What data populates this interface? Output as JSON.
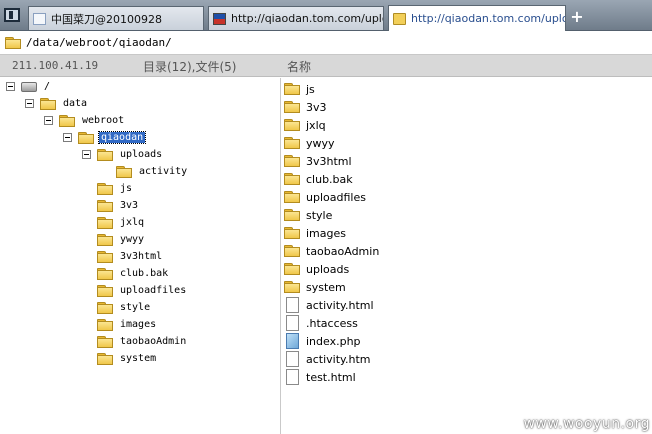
{
  "tabs": [
    {
      "label": "中国菜刀@20100928",
      "icon": "page-icon",
      "active": false
    },
    {
      "label": "http://qiaodan.tom.com/uplo...",
      "icon": "flag-icon",
      "active": false
    },
    {
      "label": "http://qiaodan.tom.com/uplo...",
      "icon": "folder-icon",
      "active": true
    }
  ],
  "new_tab_label": "+",
  "address": {
    "path": "/data/webroot/qiaodan/"
  },
  "header": {
    "ip": "211.100.41.19",
    "counts": "目录(12),文件(5)",
    "name_column": "名称"
  },
  "tree": [
    {
      "label": "/",
      "icon": "drive-icon",
      "expander": true
    },
    {
      "label": "data",
      "icon": "folder-icon",
      "expander": true
    },
    {
      "label": "webroot",
      "icon": "folder-icon",
      "expander": true
    },
    {
      "label": "qiaodan",
      "icon": "folder-icon",
      "expander": true,
      "selected": true
    },
    {
      "label": "uploads",
      "icon": "folder-icon",
      "expander": true
    },
    {
      "label": "activity",
      "icon": "folder-icon",
      "expander": false
    },
    {
      "label": "js",
      "icon": "folder-icon",
      "expander": false
    },
    {
      "label": "3v3",
      "icon": "folder-icon",
      "expander": false
    },
    {
      "label": "jxlq",
      "icon": "folder-icon",
      "expander": false
    },
    {
      "label": "ywyy",
      "icon": "folder-icon",
      "expander": false
    },
    {
      "label": "3v3html",
      "icon": "folder-icon",
      "expander": false
    },
    {
      "label": "club.bak",
      "icon": "folder-icon",
      "expander": false
    },
    {
      "label": "uploadfiles",
      "icon": "folder-icon",
      "expander": false
    },
    {
      "label": "style",
      "icon": "folder-icon",
      "expander": false
    },
    {
      "label": "images",
      "icon": "folder-icon",
      "expander": false
    },
    {
      "label": "taobaoAdmin",
      "icon": "folder-icon",
      "expander": false
    },
    {
      "label": "system",
      "icon": "folder-icon",
      "expander": false
    }
  ],
  "files": [
    {
      "name": "js",
      "icon": "folder-icon"
    },
    {
      "name": "3v3",
      "icon": "folder-icon"
    },
    {
      "name": "jxlq",
      "icon": "folder-icon"
    },
    {
      "name": "ywyy",
      "icon": "folder-icon"
    },
    {
      "name": "3v3html",
      "icon": "folder-icon"
    },
    {
      "name": "club.bak",
      "icon": "folder-icon"
    },
    {
      "name": "uploadfiles",
      "icon": "folder-icon"
    },
    {
      "name": "style",
      "icon": "folder-icon"
    },
    {
      "name": "images",
      "icon": "folder-icon"
    },
    {
      "name": "taobaoAdmin",
      "icon": "folder-icon"
    },
    {
      "name": "uploads",
      "icon": "folder-icon"
    },
    {
      "name": "system",
      "icon": "folder-icon"
    },
    {
      "name": "activity.html",
      "icon": "file-icon"
    },
    {
      "name": ".htaccess",
      "icon": "file-icon"
    },
    {
      "name": "index.php",
      "icon": "php-file-icon"
    },
    {
      "name": "activity.htm",
      "icon": "file-icon"
    },
    {
      "name": "test.html",
      "icon": "file-icon"
    }
  ],
  "watermark": "www.wooyun.org",
  "colors": {
    "selection": "#316ac5",
    "folder": "#f0c74a",
    "tabbar": "#6f7c8a"
  }
}
